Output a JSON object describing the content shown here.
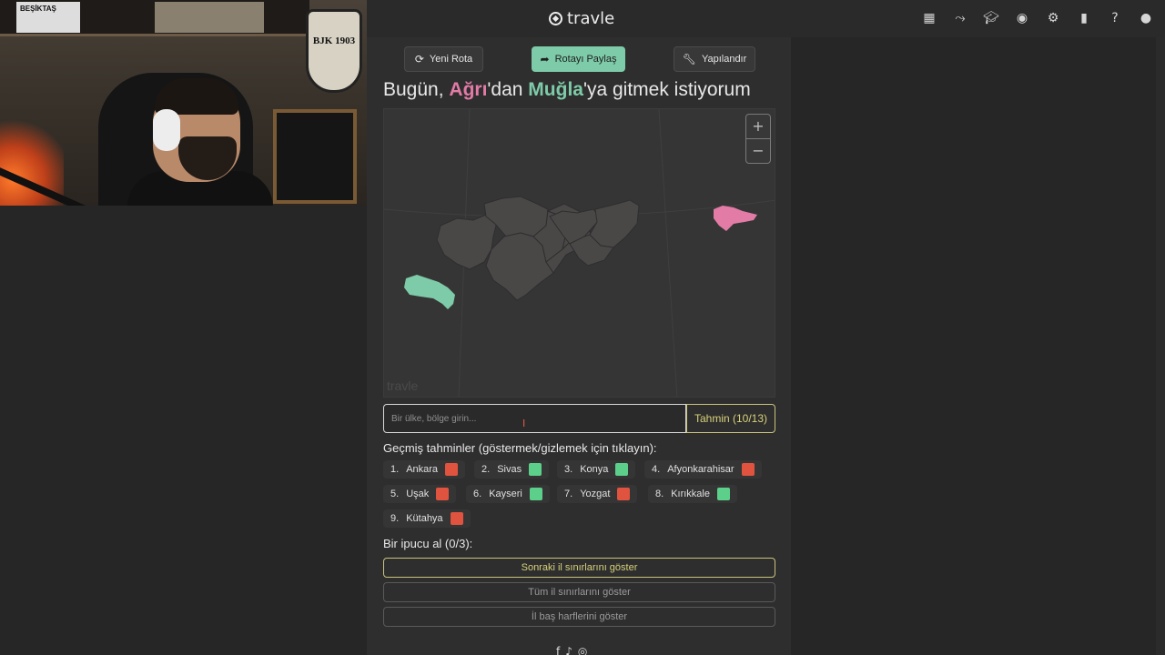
{
  "webcam": {
    "poster_text": "BEŞİKTAŞ",
    "crest_text": "BJK 1903"
  },
  "brand": {
    "name": "travle"
  },
  "topbar_icons": [
    "calendar-icon",
    "route-icon",
    "graduation-cap-icon",
    "gamepad-icon",
    "gear-icon",
    "bar-chart-icon",
    "help-icon",
    "user-icon"
  ],
  "actions": {
    "new_route": "Yeni Rota",
    "share_route": "Rotayı Paylaş",
    "configure": "Yapılandır"
  },
  "headline": {
    "prefix": "Bugün, ",
    "from": "Ağrı",
    "middle": "'dan ",
    "to": "Muğla",
    "suffix": "'ya gitmek istiyorum"
  },
  "map": {
    "zoom_in": "+",
    "zoom_out": "−",
    "watermark": "travle",
    "from_color": "#e27ba6",
    "to_color": "#7ecba9"
  },
  "guess_input": {
    "placeholder": "Bir ülke, bölge girin...",
    "button": "Tahmin (10/13)"
  },
  "history": {
    "title": "Geçmiş tahminler (göstermek/gizlemek için tıklayın):",
    "items": [
      {
        "index": "1.",
        "name": "Ankara",
        "status": "red"
      },
      {
        "index": "2.",
        "name": "Sivas",
        "status": "green"
      },
      {
        "index": "3.",
        "name": "Konya",
        "status": "green"
      },
      {
        "index": "4.",
        "name": "Afyonkarahisar",
        "status": "red"
      },
      {
        "index": "5.",
        "name": "Uşak",
        "status": "red"
      },
      {
        "index": "6.",
        "name": "Kayseri",
        "status": "green"
      },
      {
        "index": "7.",
        "name": "Yozgat",
        "status": "red"
      },
      {
        "index": "8.",
        "name": "Kırıkkale",
        "status": "green"
      },
      {
        "index": "9.",
        "name": "Kütahya",
        "status": "red"
      }
    ]
  },
  "hints": {
    "title": "Bir ipucu al (0/3):",
    "next_borders": "Sonraki il sınırlarını göster",
    "all_borders": "Tüm il sınırlarını göster",
    "initials": "İl baş harflerini göster"
  }
}
